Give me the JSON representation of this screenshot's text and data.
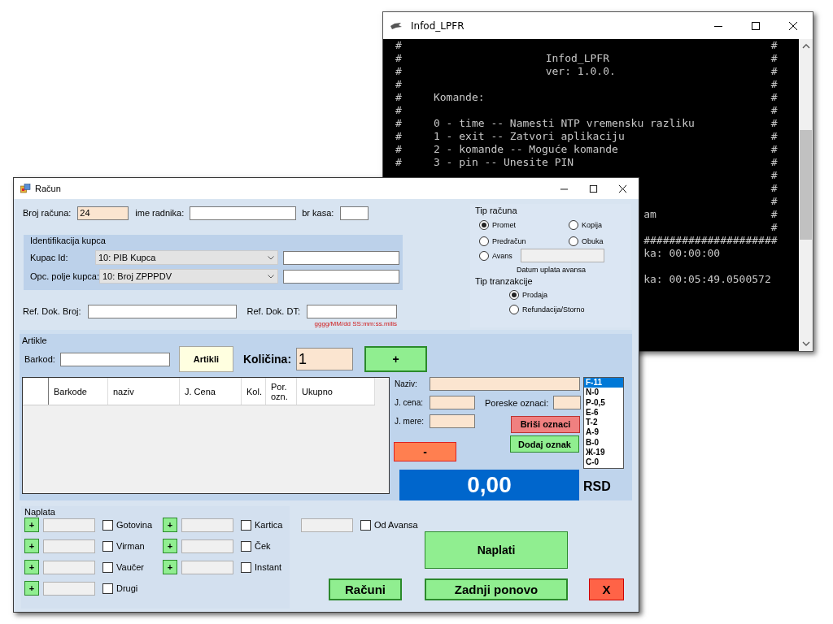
{
  "console_window": {
    "title": "Infod_LPFR",
    "rows": [
      {
        "kind": "line",
        "left": "#",
        "right": "#"
      },
      {
        "kind": "heading",
        "left": "#",
        "text": "Infod_LPFR",
        "right": "#"
      },
      {
        "kind": "heading",
        "left": "#",
        "text": "ver: 1.0.0.",
        "right": "#"
      },
      {
        "kind": "line",
        "left": "#",
        "right": "#"
      },
      {
        "kind": "line",
        "left": "#",
        "text": "Komande:",
        "right": "#"
      },
      {
        "kind": "line",
        "left": "#",
        "right": "#"
      },
      {
        "kind": "line",
        "left": "#",
        "text": "0 - time -- Namesti NTP vremensku razliku",
        "right": "#"
      },
      {
        "kind": "line",
        "left": "#",
        "text": "1 - exit -- Zatvori aplikaciju",
        "right": "#"
      },
      {
        "kind": "line",
        "left": "#",
        "text": "2 - komande -- Moguće komande",
        "right": "#"
      },
      {
        "kind": "line",
        "left": "#",
        "text": "3 - pin -- Unesite PIN",
        "right": "#"
      },
      {
        "kind": "tail",
        "right": "#"
      },
      {
        "kind": "tail",
        "right": "#"
      },
      {
        "kind": "tail",
        "right": "#"
      },
      {
        "kind": "tail",
        "text": "am",
        "right": "#"
      },
      {
        "kind": "tail",
        "right": "#"
      },
      {
        "kind": "tail",
        "text": "#####################"
      },
      {
        "kind": "tail",
        "text": "ka: 00:00:00"
      },
      {
        "kind": "tail"
      },
      {
        "kind": "tail",
        "text": "ka: 00:05:49.0500572"
      }
    ]
  },
  "invoice_window": {
    "title": "Račun",
    "header_fields": [
      {
        "kind": "readonly",
        "label": "Broj računa:",
        "value": "24"
      },
      {
        "kind": "text",
        "label": "ime radnika:"
      },
      {
        "kind": "text",
        "label": "br kasa:"
      }
    ],
    "customer": {
      "title": "Identifikacija kupca",
      "rows": [
        {
          "label": "Kupac Id:",
          "option": "10: PIB Kupca"
        },
        {
          "label": "Opc. polje kupca:",
          "option": "10: Broj ZPPPDV"
        }
      ]
    },
    "reference": {
      "number_label": "Ref. Dok. Broj:",
      "date_label": "Ref. Dok. DT:",
      "date_hint": "gggg/MM/dd SS:mm:ss.milis"
    },
    "invoice_type": {
      "title": "Tip računa",
      "options": [
        {
          "label": "Promet",
          "selected": true
        },
        {
          "label": "Kopija",
          "selected": false
        },
        {
          "label": "Predračun",
          "selected": false
        },
        {
          "label": "Obuka",
          "selected": false
        },
        {
          "label": "Avans",
          "selected": false
        }
      ],
      "advance_date_caption": "Datum uplata avansa"
    },
    "transaction_type": {
      "title": "Tip tranzakcije",
      "options": [
        {
          "label": "Prodaja",
          "selected": true
        },
        {
          "label": "Refundacija/Storno",
          "selected": false
        }
      ]
    },
    "articles": {
      "title": "Artikle",
      "barcode_label": "Barkod:",
      "articles_button": "Artikli",
      "quantity_label": "Količina:",
      "quantity": "1",
      "add_button": "+",
      "columns": [
        "Barkode",
        "naziv",
        "J. Cena",
        "Kol.",
        "Por. ozn.",
        "Ukupno"
      ],
      "name_label": "Naziv:",
      "price_label": "J. cena:",
      "tax_label": "Poreske oznaci:",
      "unit_label": "J. mere:",
      "delete_tags_button": "Briši oznaci",
      "add_tag_button": "Dodaj oznak",
      "remove_button": "-",
      "total": "0,00",
      "currency": "RSD",
      "tax_tags": [
        {
          "label": "F-11",
          "selected": true
        },
        {
          "label": "N-0",
          "selected": false
        },
        {
          "label": "P-0,5",
          "selected": false
        },
        {
          "label": "E-6",
          "selected": false
        },
        {
          "label": "T-2",
          "selected": false
        },
        {
          "label": "A-9",
          "selected": false
        },
        {
          "label": "B-0",
          "selected": false
        },
        {
          "label": "Ж-19",
          "selected": false
        },
        {
          "label": "C-0",
          "selected": false
        }
      ]
    },
    "payment": {
      "title": "Naplata",
      "columns": [
        {
          "methods": [
            {
              "add": "+",
              "label": "Gotovina",
              "checked": false
            },
            {
              "add": "+",
              "label": "Virman",
              "checked": false
            },
            {
              "add": "+",
              "label": "Vaučer",
              "checked": false
            },
            {
              "add": "+",
              "label": "Drugi",
              "checked": false
            }
          ]
        },
        {
          "methods": [
            {
              "add": "+",
              "label": "Kartica",
              "checked": false
            },
            {
              "add": "+",
              "label": "Ček",
              "checked": false
            },
            {
              "add": "+",
              "label": "Instant",
              "checked": false
            }
          ]
        }
      ],
      "advance": {
        "label": "Od Avansa",
        "checked": false
      },
      "pay_button": "Naplati",
      "invoices_button": "Računi",
      "reprint_button": "Zadnji ponovo",
      "close_button": "X"
    }
  }
}
